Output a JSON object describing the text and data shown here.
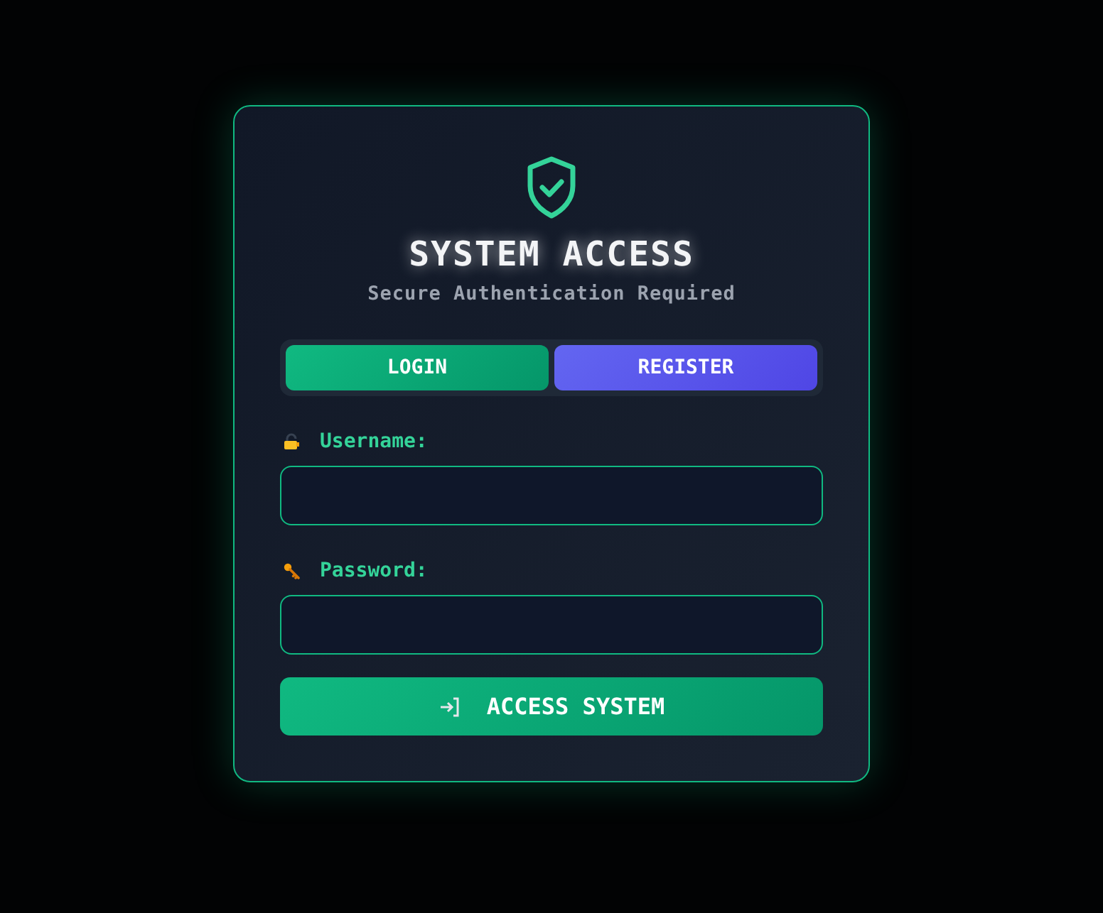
{
  "title": "SYSTEM ACCESS",
  "subtitle": "Secure Authentication Required",
  "tabs": [
    {
      "label": "LOGIN",
      "selected": true
    },
    {
      "label": "REGISTER",
      "selected": false
    }
  ],
  "fields": [
    {
      "kind": "text",
      "label": "Username:"
    },
    {
      "kind": "password",
      "label": "Password:"
    }
  ],
  "submit": {
    "label": "ACCESS SYSTEM"
  }
}
